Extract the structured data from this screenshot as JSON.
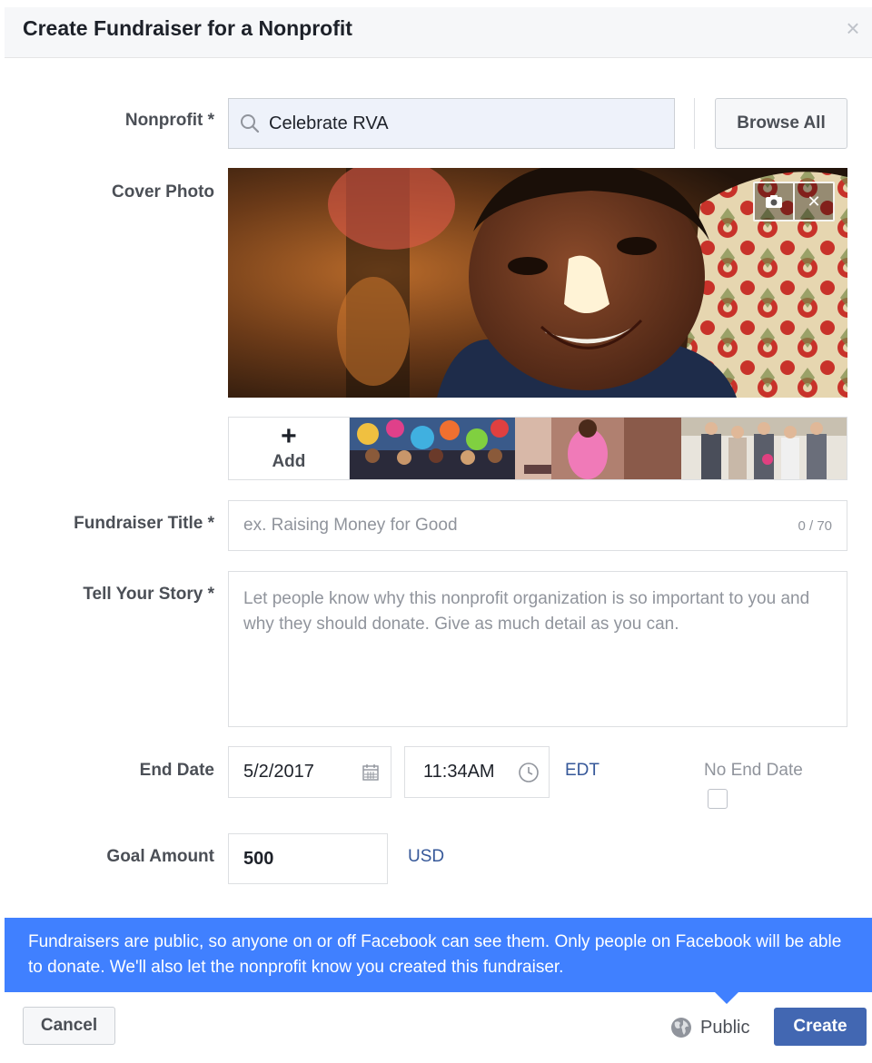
{
  "dialog": {
    "title": "Create Fundraiser for a Nonprofit",
    "close_icon": "close-icon"
  },
  "form": {
    "nonprofit": {
      "label": "Nonprofit *",
      "value": "Celebrate RVA",
      "icon": "search-icon"
    },
    "browse_all_label": "Browse All",
    "cover_photo": {
      "label": "Cover Photo",
      "actions": [
        {
          "icon": "camera-icon"
        },
        {
          "icon": "close-icon"
        }
      ],
      "add_label": "Add",
      "add_icon": "plus-icon",
      "thumbnails": [
        "balloons-crowd-photo",
        "girl-dancing-photo",
        "wedding-party-photo"
      ]
    },
    "fundraiser_title": {
      "label": "Fundraiser Title *",
      "placeholder": "ex. Raising Money for Good",
      "counter": "0 / 70"
    },
    "story": {
      "label": "Tell Your Story *",
      "placeholder": "Let people know why this nonprofit organization is so important to you and why they should donate. Give as much detail as you can."
    },
    "end_date": {
      "label": "End Date",
      "date": "5/2/2017",
      "date_icon": "calendar-icon",
      "time": "11:34AM",
      "time_icon": "clock-icon",
      "timezone": "EDT",
      "no_end_date_label": "No End Date",
      "no_end_date_checked": false
    },
    "goal": {
      "label": "Goal Amount",
      "value": "500",
      "currency": "USD"
    }
  },
  "notice": {
    "text": "Fundraisers are public, so anyone on or off Facebook can see them. Only people on Facebook will be able to donate. We'll also let the nonprofit know you created this fundraiser.",
    "color": "#4080ff"
  },
  "footer": {
    "cancel_label": "Cancel",
    "privacy_label": "Public",
    "privacy_icon": "globe-icon",
    "create_label": "Create",
    "create_color": "#4267b2"
  }
}
